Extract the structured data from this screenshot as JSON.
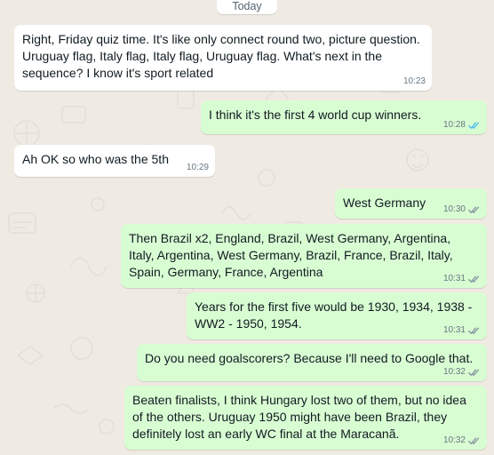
{
  "date_divider": "Today",
  "colors": {
    "wallpaper": "#efeae2",
    "incoming_bubble": "#ffffff",
    "outgoing_bubble": "#d9fdd3",
    "text": "#111b21",
    "meta": "#667781",
    "read_tick": "#53bdeb",
    "sent_tick": "#8696a0"
  },
  "messages": [
    {
      "direction": "incoming",
      "text": "Right, Friday quiz time. It's like only connect round two, picture question. Uruguay flag, Italy flag, Italy flag, Uruguay flag. What's next in the sequence? I know it's sport related",
      "time": "10:23"
    },
    {
      "direction": "outgoing",
      "text": "I think it's the first 4 world cup winners.",
      "time": "10:28",
      "status": "read",
      "status_icon": "double-check-blue-icon"
    },
    {
      "direction": "incoming",
      "text": "Ah OK so who was the 5th",
      "time": "10:29"
    },
    {
      "direction": "outgoing",
      "text": "West Germany",
      "time": "10:30",
      "status": "delivered",
      "status_icon": "double-check-grey-icon"
    },
    {
      "direction": "outgoing",
      "text": "Then Brazil x2, England, Brazil, West Germany, Argentina, Italy, Argentina, West Germany, Brazil, France, Brazil, Italy, Spain, Germany, France, Argentina",
      "time": "10:31",
      "status": "delivered",
      "status_icon": "double-check-grey-icon"
    },
    {
      "direction": "outgoing",
      "text": "Years for the first five would be 1930, 1934, 1938 - WW2 - 1950, 1954.",
      "time": "10:31",
      "status": "delivered",
      "status_icon": "double-check-grey-icon"
    },
    {
      "direction": "outgoing",
      "text": "Do you need goalscorers? Because I'll need to Google that.",
      "time": "10:32",
      "status": "delivered",
      "status_icon": "double-check-grey-icon"
    },
    {
      "direction": "outgoing",
      "text": "Beaten finalists, I think Hungary lost two of them, but no idea of the others. Uruguay 1950 might have been Brazil, they definitely lost an early WC final at the Maracanã.",
      "time": "10:32",
      "status": "delivered",
      "status_icon": "double-check-grey-icon"
    }
  ]
}
